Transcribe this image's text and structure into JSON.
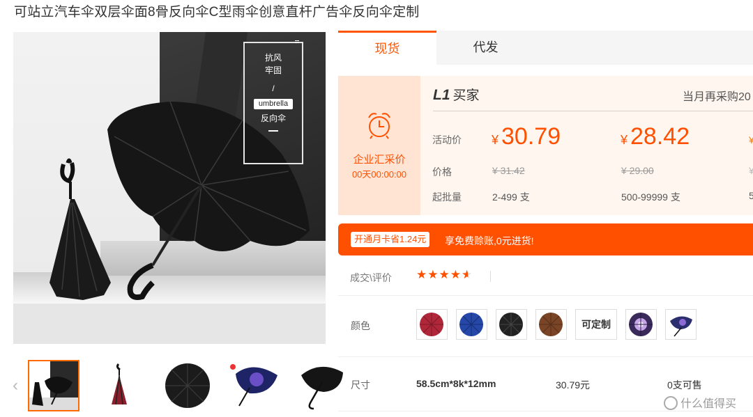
{
  "product": {
    "title": "可站立汽车伞双层伞面8骨反向伞C型雨伞创意直杆广告伞反向伞定制"
  },
  "main_image": {
    "sign_lines": [
      "抗风",
      "牢固",
      "/"
    ],
    "sign_pill": "umbrella",
    "sign_bottom": "反向伞"
  },
  "gallery": {
    "prev_icon": "‹",
    "next_icon": "›"
  },
  "tabs": [
    {
      "label": "现货"
    },
    {
      "label": "代发"
    }
  ],
  "price_panel": {
    "biz_label": "企业汇采价",
    "countdown": "00天00:00:00",
    "buyer_level": "L1",
    "buyer_label": "买家",
    "right_note": "当月再采购20",
    "row_labels": {
      "activity": "活动价",
      "price": "价格",
      "moq": "起批量"
    },
    "tiers": [
      {
        "yen": "¥",
        "activity_price": "30.79",
        "original": "¥ 31.42",
        "moq": "2-499 支"
      },
      {
        "yen": "¥",
        "activity_price": "28.42",
        "original": "¥ 29.00",
        "moq": "500-99999 支"
      }
    ],
    "cut_glyphs": [
      "¥",
      "¥",
      "5"
    ]
  },
  "promo": {
    "tag": "开通月卡省1.24元",
    "text": "享免费赊账,0元进货!"
  },
  "rating": {
    "label": "成交\\评价",
    "stars": 4.5
  },
  "color": {
    "label": "颜色",
    "options": [
      {
        "name": "red",
        "color": "#b0273a"
      },
      {
        "name": "blue",
        "color": "#2547a8"
      },
      {
        "name": "black",
        "color": "#222222"
      },
      {
        "name": "brown",
        "color": "#7a4526"
      },
      {
        "name": "custom",
        "label": "可定制"
      },
      {
        "name": "starry",
        "color": "#3a2a5c"
      },
      {
        "name": "starry-reverse",
        "color": "#2c2f6e"
      }
    ]
  },
  "size": {
    "label": "尺寸",
    "name": "58.5cm*8k*12mm",
    "price": "30.79元",
    "stock": "0支可售"
  },
  "watermark": {
    "text": "什么值得买"
  }
}
